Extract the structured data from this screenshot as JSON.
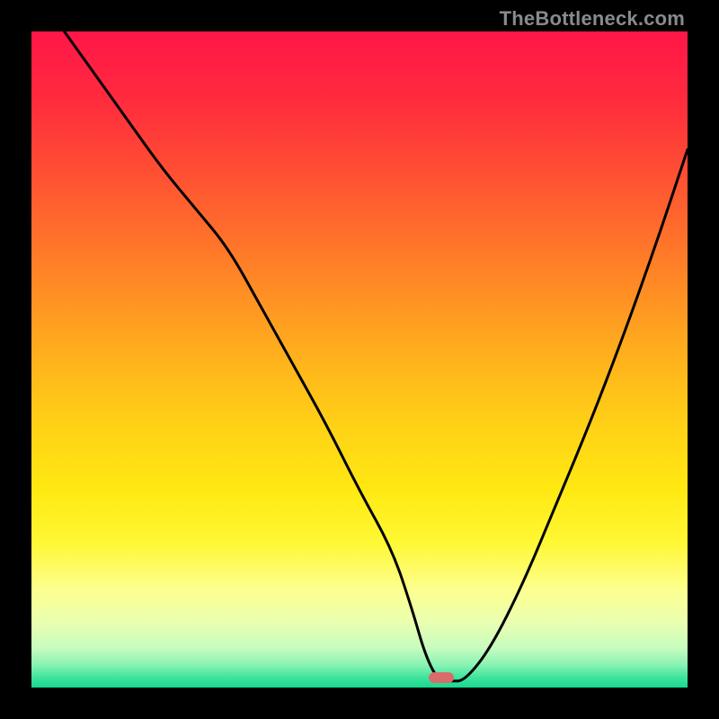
{
  "watermark": "TheBottleneck.com",
  "gradient": {
    "stops": [
      {
        "offset": 0.0,
        "color": "#ff1648"
      },
      {
        "offset": 0.1,
        "color": "#ff2a3e"
      },
      {
        "offset": 0.2,
        "color": "#ff4a34"
      },
      {
        "offset": 0.3,
        "color": "#ff6c2c"
      },
      {
        "offset": 0.4,
        "color": "#ff8f24"
      },
      {
        "offset": 0.5,
        "color": "#ffb21c"
      },
      {
        "offset": 0.6,
        "color": "#ffd116"
      },
      {
        "offset": 0.7,
        "color": "#ffe912"
      },
      {
        "offset": 0.78,
        "color": "#fff835"
      },
      {
        "offset": 0.85,
        "color": "#fdff8e"
      },
      {
        "offset": 0.9,
        "color": "#eaffb0"
      },
      {
        "offset": 0.94,
        "color": "#c7fcbf"
      },
      {
        "offset": 0.965,
        "color": "#8af3b3"
      },
      {
        "offset": 0.985,
        "color": "#3ee39d"
      },
      {
        "offset": 1.0,
        "color": "#17d98e"
      }
    ]
  },
  "marker": {
    "x_frac": 0.625,
    "y_frac": 0.985,
    "color": "#d96b6b"
  },
  "curve": {
    "stroke": "#000000",
    "stroke_width": 3
  },
  "chart_data": {
    "type": "line",
    "title": "",
    "xlabel": "",
    "ylabel": "",
    "xlim": [
      0,
      100
    ],
    "ylim": [
      0,
      100
    ],
    "grid": false,
    "legend": false,
    "series": [
      {
        "name": "bottleneck-curve",
        "x": [
          5,
          10,
          15,
          20,
          25,
          30,
          35,
          40,
          45,
          50,
          55,
          58,
          60,
          62,
          64,
          66,
          70,
          75,
          80,
          85,
          90,
          95,
          100
        ],
        "y": [
          100,
          93,
          86,
          79,
          73,
          67,
          58,
          49,
          40,
          30,
          21,
          12,
          5,
          1,
          1,
          1,
          6,
          16,
          28,
          40,
          53,
          67,
          82
        ]
      }
    ],
    "annotations": [
      {
        "type": "marker",
        "x": 62.5,
        "y": 1.5,
        "label": "optimal-point"
      }
    ]
  }
}
